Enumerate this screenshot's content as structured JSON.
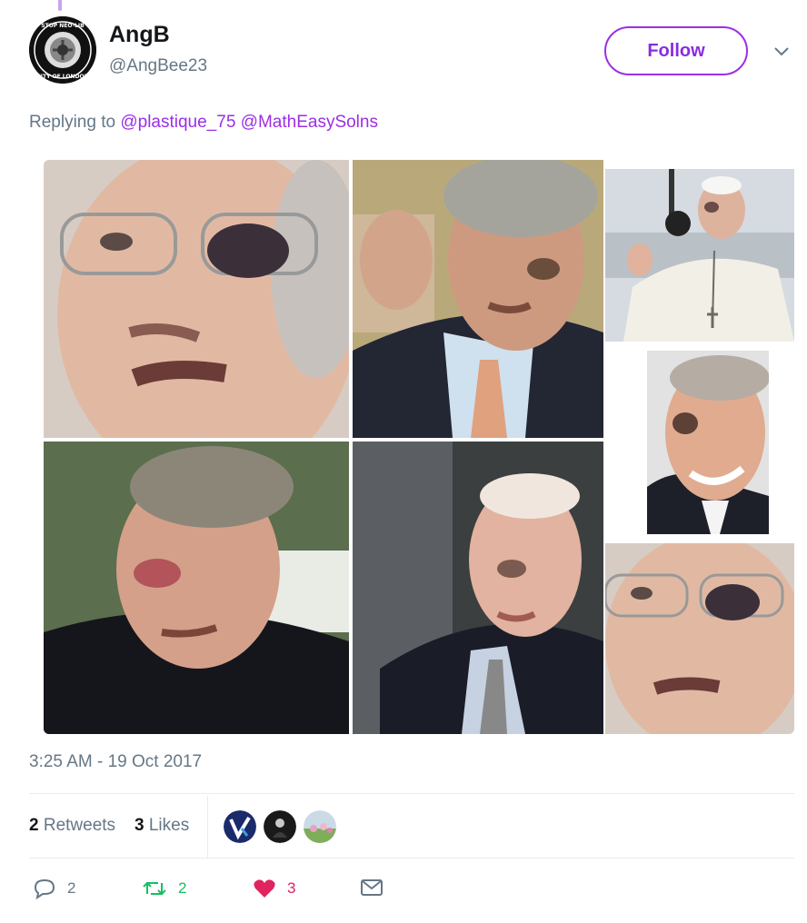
{
  "tweet": {
    "author": {
      "name": "AngB",
      "handle": "@AngBee23",
      "avatar_text": "STOP NEO-LIBERALISM · CITY OF LONDON"
    },
    "follow_label": "Follow",
    "replying_prefix": "Replying to",
    "reply_mentions": [
      "@plastique_75",
      "@MathEasySolns"
    ],
    "timestamp": "3:25 AM - 19 Oct 2017",
    "retweets_count": "2",
    "retweets_label": "Retweets",
    "likes_count": "3",
    "likes_label": "Likes",
    "actions": {
      "reply_count": "2",
      "retweet_count": "2",
      "like_count": "3"
    }
  },
  "colors": {
    "accent": "#9b2ee6",
    "muted": "#657786",
    "retweet": "#17bf63",
    "like": "#e0245e"
  },
  "icons": {
    "reply": "reply-icon",
    "retweet": "retweet-icon",
    "like": "heart-icon",
    "dm": "envelope-icon",
    "caret": "chevron-down-icon"
  }
}
